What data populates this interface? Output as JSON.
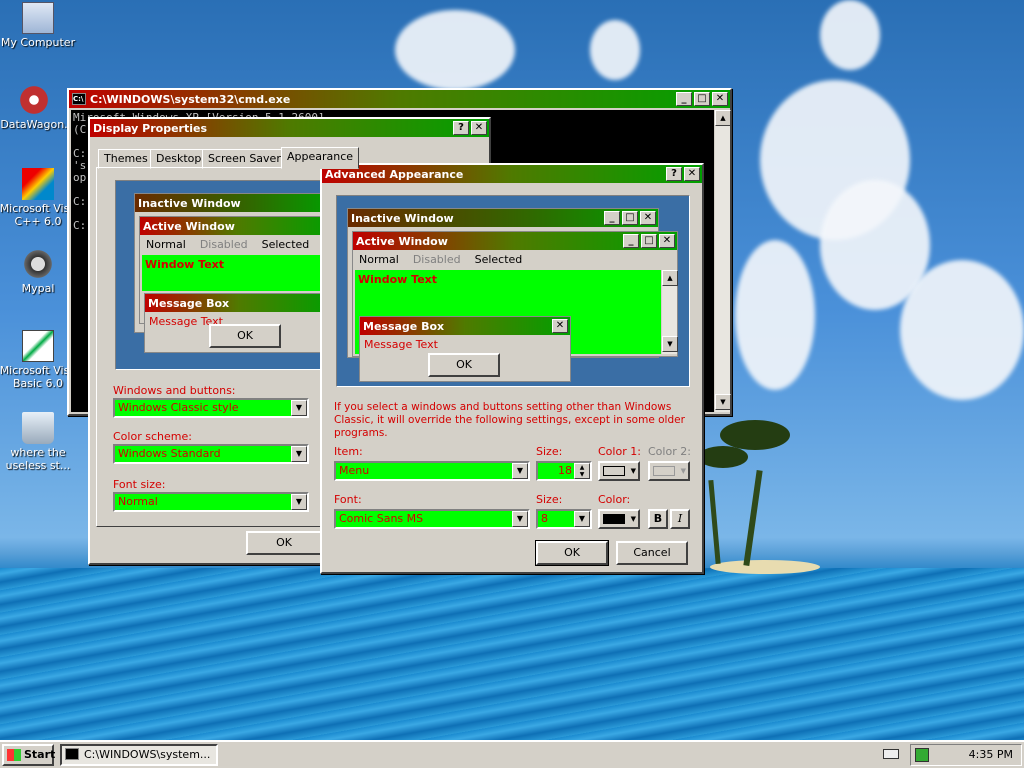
{
  "desktop": {
    "icons": [
      {
        "name": "my-computer",
        "label": "My Computer"
      },
      {
        "name": "datawagon",
        "label": "DataWagon."
      },
      {
        "name": "visual-cpp",
        "label": "Microsoft Visu C++ 6.0"
      },
      {
        "name": "mypal",
        "label": "Mypal"
      },
      {
        "name": "visual-basic",
        "label": "Microsoft Visu Basic 6.0"
      },
      {
        "name": "recycle-bin",
        "label": "where the useless st..."
      }
    ]
  },
  "cmd": {
    "title": "C:\\WINDOWS\\system32\\cmd.exe",
    "lines": [
      "Mi",
      "(C",
      "",
      "C:",
      "'s",
      "op",
      "",
      "C:",
      "",
      "C:"
    ],
    "partial_line": "rosoft Windows XP [Version 5.1.2600]"
  },
  "display_props": {
    "title": "Display Properties",
    "tabs": [
      "Themes",
      "Desktop",
      "Screen Saver",
      "Appearance"
    ],
    "preview": {
      "inactive_title": "Inactive Window",
      "active_title": "Active Window",
      "menu": [
        "Normal",
        "Disabled",
        "Selected"
      ],
      "window_text": "Window Text",
      "msgbox_title": "Message Box",
      "msgbox_text": "Message Text",
      "ok": "OK"
    },
    "windows_buttons_label": "Windows and buttons:",
    "windows_buttons_value": "Windows Classic style",
    "color_scheme_label": "Color scheme:",
    "color_scheme_value": "Windows Standard",
    "font_size_label": "Font size:",
    "font_size_value": "Normal",
    "ok": "OK"
  },
  "advanced": {
    "title": "Advanced Appearance",
    "preview": {
      "inactive_title": "Inactive Window",
      "active_title": "Active Window",
      "menu": [
        "Normal",
        "Disabled",
        "Selected"
      ],
      "window_text": "Window Text",
      "msgbox_title": "Message Box",
      "msgbox_text": "Message Text",
      "ok": "OK"
    },
    "note": "If you select a windows and buttons setting other than Windows Classic, it will override the following settings, except in some older programs.",
    "item_label": "Item:",
    "item_value": "Menu",
    "size_label": "Size:",
    "size_value": "18",
    "color1_label": "Color 1:",
    "color2_label": "Color 2:",
    "font_label": "Font:",
    "font_value": "Comic Sans MS",
    "font_size_label": "Size:",
    "font_size_value": "8",
    "color_label": "Color:",
    "bold": "B",
    "italic": "I",
    "ok": "OK",
    "cancel": "Cancel"
  },
  "taskbar": {
    "start": "Start",
    "task": "C:\\WINDOWS\\system...",
    "clock": "4:35 PM"
  },
  "colors": {
    "title_active": "#c00000",
    "title_end": "#00a000",
    "window_bg": "#00ff00",
    "text_red": "#d40000",
    "face": "#d4d0c8"
  }
}
